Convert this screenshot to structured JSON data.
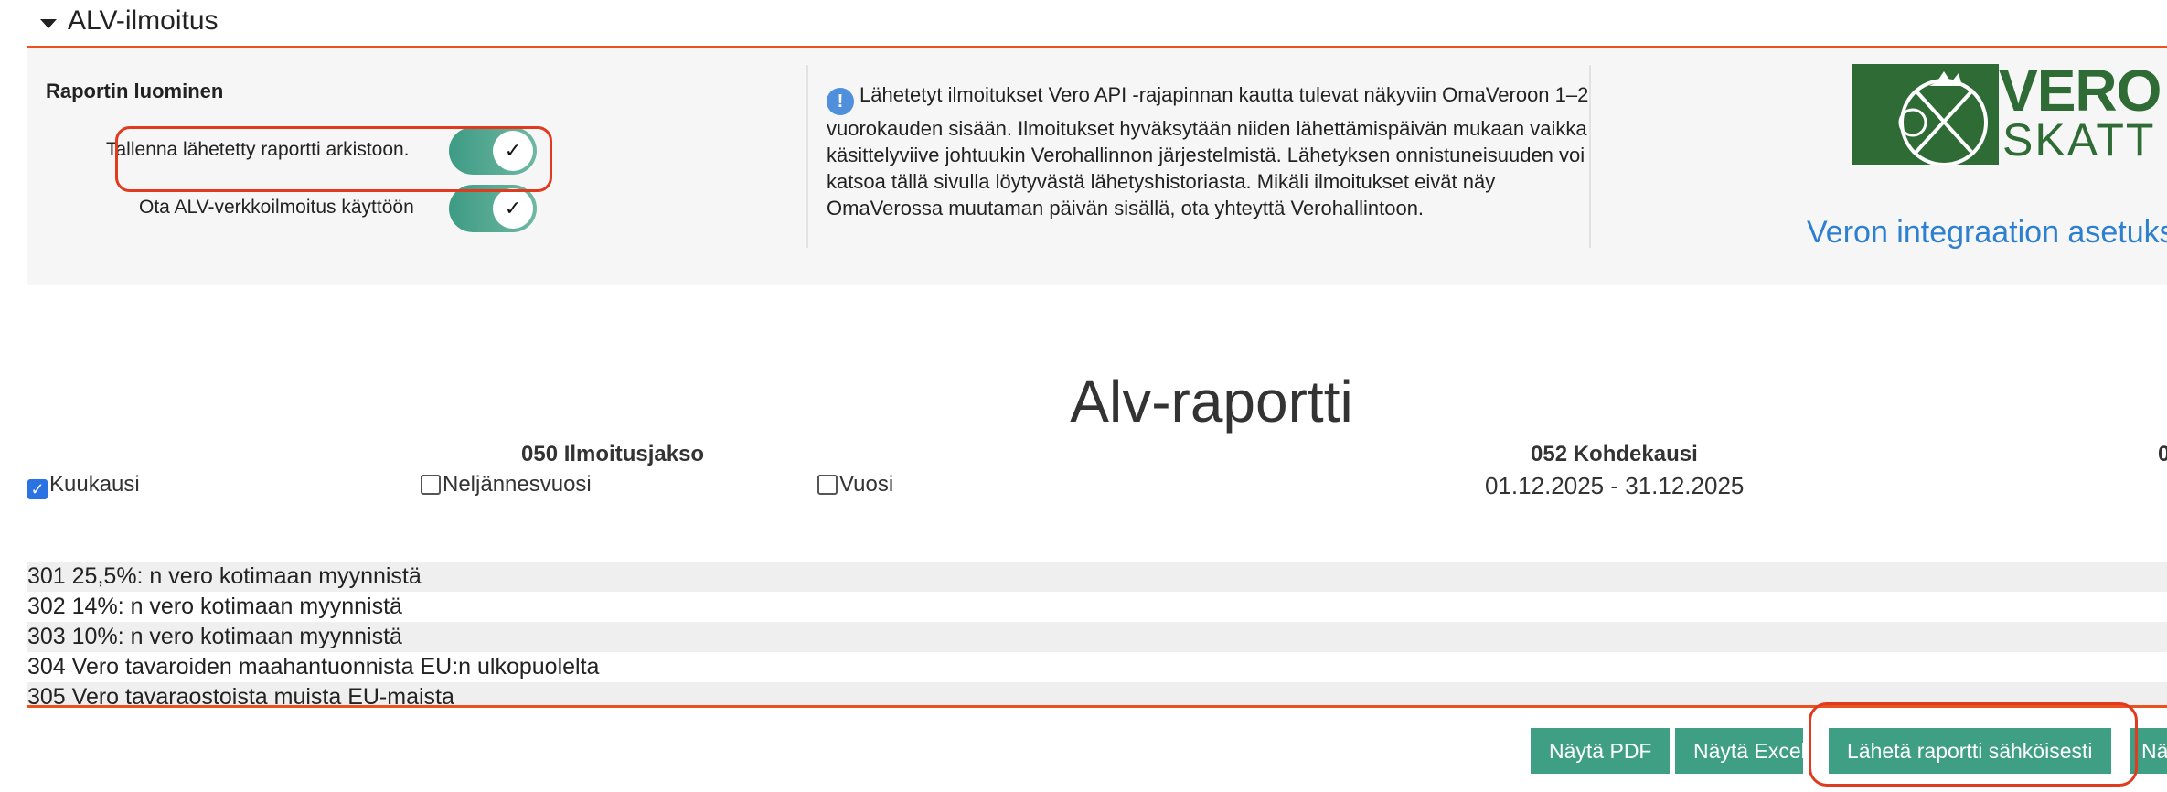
{
  "section": {
    "title": "ALV-ilmoitus"
  },
  "panel": {
    "title": "Raportin luominen",
    "toggles": [
      {
        "label": "Tallenna lähetetty raportti arkistoon.",
        "checked": true
      },
      {
        "label": "Ota ALV-verkkoilmoitus käyttöön",
        "checked": true
      }
    ],
    "info_text": "Lähetetyt ilmoitukset Vero API -rajapinnan kautta tulevat näkyviin OmaVeroon 1–2 vuorokauden sisään. Ilmoitukset hyväksytään niiden lähettämispäivän mukaan vaikka käsittelyviive johtuukin Verohallinnon järjestelmistä. Lähetyksen onnistuneisuuden voi katsoa tällä sivulla löytyvästä lähetyshistoriasta. Mikäli ilmoitukset eivät näy OmaVerossa muutaman päivän sisällä, ota yhteyttä Verohallintoon.",
    "logo": {
      "line1": "VERO",
      "line2": "SKATT"
    },
    "settings_link": "Veron integraation asetukset"
  },
  "report": {
    "title": "Alv-raportti",
    "col_period_head": "050 Ilmoitusjakso",
    "col_target_head": "052 Kohdekausi",
    "col_extra_head": "0",
    "periods": [
      {
        "label": "Kuukausi",
        "checked": true
      },
      {
        "label": "Neljännesvuosi",
        "checked": false
      },
      {
        "label": "Vuosi",
        "checked": false
      }
    ],
    "date_range": "01.12.2025 - 31.12.2025",
    "rows": [
      "301 25,5%: n vero kotimaan myynnistä",
      "302 14%: n vero kotimaan myynnistä",
      "303 10%: n vero kotimaan myynnistä",
      "304 Vero tavaroiden maahantuonnista EU:n ulkopuolelta",
      "305 Vero tavaraostoista muista EU-maista"
    ]
  },
  "actions": {
    "show_pdf": "Näytä PDF",
    "show_excel": "Näytä Excel",
    "send": "Lähetä raportti sähköisesti",
    "more": "Nä"
  },
  "colors": {
    "accent": "#e9531f",
    "button": "#3f9f85",
    "link": "#2d7fcf",
    "logo": "#2f6b35"
  }
}
